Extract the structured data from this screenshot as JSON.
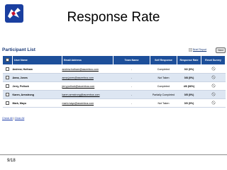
{
  "slide": {
    "title": "Response Rate",
    "page_number": "9/18"
  },
  "panel": {
    "title": "Participant List",
    "brief_report_label": "Brief Report",
    "next_button_label": "Next",
    "columns": [
      "",
      "User Name",
      "Email Address",
      "Team Name",
      "Self Response",
      "Response Rate",
      "Reset Survey"
    ],
    "rows": [
      {
        "name": "Andrew, Hotham",
        "email": "andrew.hotham@ascenbus.com",
        "team": "-",
        "status": "Completed",
        "rate": "0/2 (0%)"
      },
      {
        "name": "Anna, Jones",
        "email": "anna.jones@ascenbus.com",
        "team": "-",
        "status": "Not Taken",
        "rate": "0/8 (0%)"
      },
      {
        "name": "Jerry, Pollock",
        "email": "jerry.pollock@ascenbus.com",
        "team": "-",
        "status": "Completed",
        "rate": "4/6 (66%)"
      },
      {
        "name": "Karen, Armstrong",
        "email": "karen.armstrong@ascenbus.com",
        "team": "-",
        "status": "Partially Completed",
        "rate": "0/5 (0%)"
      },
      {
        "name": "Mark, Mayo",
        "email": "mark.mayo@ascenbus.com",
        "team": "-",
        "status": "Not Taken",
        "rate": "0/0 (0%)"
      }
    ],
    "check_all_label": "Check All",
    "clear_all_label": "Clear All",
    "footer_separator": "|"
  },
  "icons": {
    "logo": "eagle-logo-icon",
    "brief_report": "report-icon",
    "reset": "reset-survey-icon"
  },
  "colors": {
    "header_bg": "#1d4f9a",
    "alt_row": "#dde6f2",
    "rate_text": "#c01818",
    "link": "#1a3aa8"
  }
}
